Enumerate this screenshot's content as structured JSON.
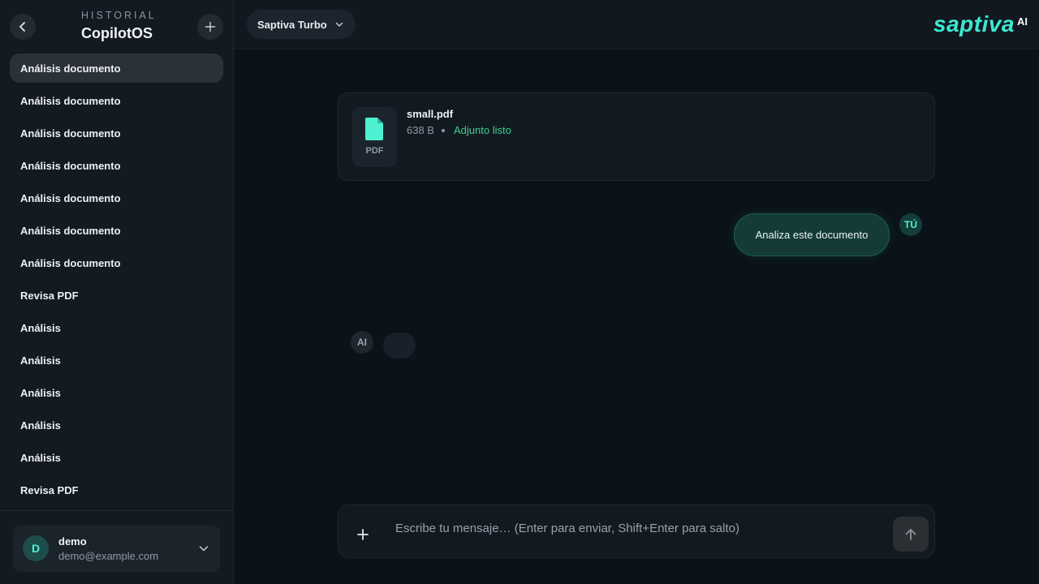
{
  "sidebar": {
    "eyebrow": "HISTORIAL",
    "title": "CopilotOS",
    "back_icon": "chevron-left-icon",
    "new_icon": "plus-icon",
    "items": [
      {
        "label": "Análisis documento",
        "active": true
      },
      {
        "label": "Análisis documento"
      },
      {
        "label": "Análisis documento"
      },
      {
        "label": "Análisis documento"
      },
      {
        "label": "Análisis documento"
      },
      {
        "label": "Análisis documento"
      },
      {
        "label": "Análisis documento"
      },
      {
        "label": "Revisa PDF"
      },
      {
        "label": "Análisis"
      },
      {
        "label": "Análisis"
      },
      {
        "label": "Análisis"
      },
      {
        "label": "Análisis"
      },
      {
        "label": "Análisis"
      },
      {
        "label": "Revisa PDF"
      }
    ],
    "user": {
      "initial": "D",
      "name": "demo",
      "email": "demo@example.com"
    }
  },
  "topbar": {
    "model": "Saptiva Turbo",
    "logo_word": "saptiva",
    "logo_suffix": "AI"
  },
  "chat": {
    "attachment": {
      "file_name": "small.pdf",
      "file_type": "PDF",
      "size": "638 B",
      "status": "Adjunto listo"
    },
    "user_message": "Analiza este documento",
    "user_avatar": "TÚ",
    "ai_avatar": "AI"
  },
  "composer": {
    "placeholder": "Escribe tu mensaje… (Enter para enviar, Shift+Enter para salto)",
    "value": ""
  },
  "colors": {
    "accent": "#3de8cf",
    "status_ok": "#3fcf8e",
    "background": "#0b1219",
    "sidebar": "#131a21"
  }
}
